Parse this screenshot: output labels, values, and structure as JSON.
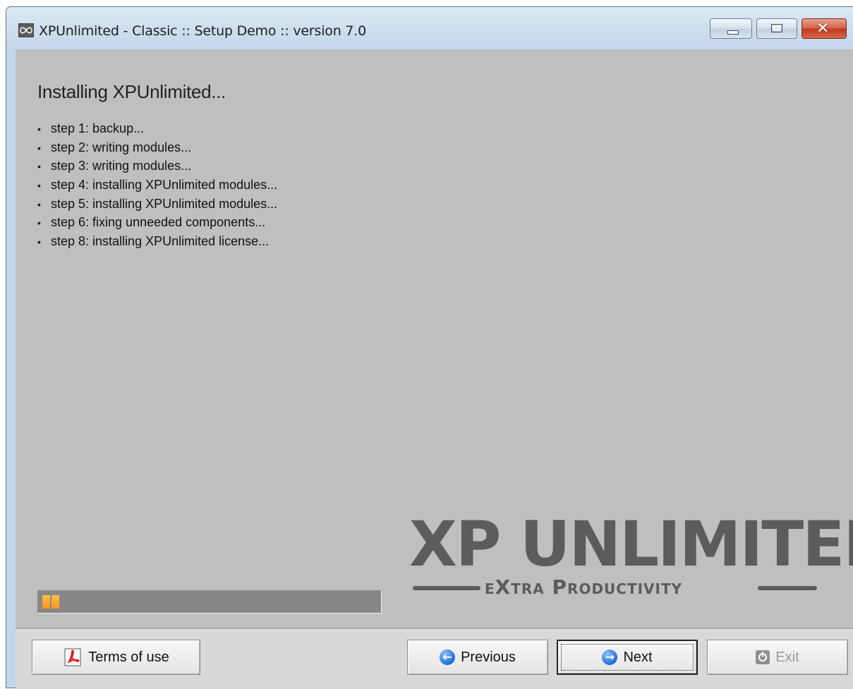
{
  "window": {
    "title": "XPUnlimited - Classic :: Setup Demo :: version 7.0"
  },
  "titlebar_buttons": [
    "minimize",
    "maximize",
    "close"
  ],
  "content": {
    "heading": "Installing XPUnlimited...",
    "steps": [
      "step 1: backup...",
      "step 2: writing modules...",
      "step 3: writing modules...",
      "step 4: installing XPUnlimited modules...",
      "step 5: installing XPUnlimited modules...",
      "step 6: fixing unneeded components...",
      "step 8: installing XPUnlimited license..."
    ],
    "progress": {
      "blocks_filled": 2,
      "fill_color": "#f7941d"
    }
  },
  "logo": {
    "main": "XP UNLIMITED",
    "tagline": "eXtra Productivity"
  },
  "buttons": {
    "terms": {
      "label": "Terms of use",
      "icon": "pdf-icon"
    },
    "previous": {
      "label": "Previous",
      "icon": "arrow-left-circle-icon"
    },
    "next": {
      "label": "Next",
      "icon": "arrow-right-circle-icon"
    },
    "exit": {
      "label": "Exit",
      "icon": "power-icon",
      "disabled": true
    }
  },
  "colors": {
    "client_bg": "#bfbfbf",
    "logo": "#5c5c5c",
    "accent": "#f7941d"
  }
}
